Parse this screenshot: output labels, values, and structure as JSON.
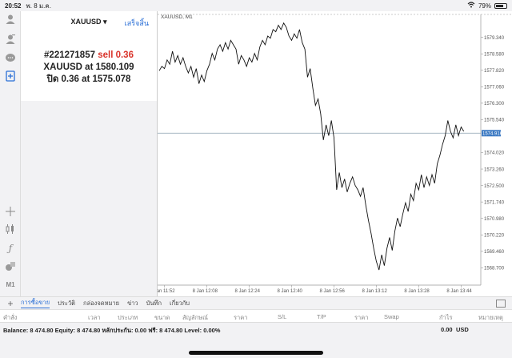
{
  "statusbar": {
    "time": "20:52",
    "date": "พ. 8 ม.ค.",
    "battery": "79%",
    "battery_level": 0.79
  },
  "left_tools": [
    {
      "icon": "person-icon"
    },
    {
      "icon": "person-add-icon"
    },
    {
      "icon": "chat-icon"
    },
    {
      "icon": "new-order-icon"
    },
    {
      "icon": "crosshair-icon"
    },
    {
      "icon": "candles-icon"
    },
    {
      "icon": "function-icon"
    },
    {
      "icon": "objects-icon"
    },
    {
      "icon": "timeframe-label",
      "label": "M1"
    }
  ],
  "order_panel": {
    "symbol": "XAUUSD ▾",
    "done": "เสร็จสิ้น",
    "ticket": "#221271857",
    "side": "sell 0.36",
    "open_line": "XAUUSD at 1580.109",
    "close_line": "ปิด 0.36 at 1575.078"
  },
  "chart_data": {
    "type": "line",
    "title": "XAUUSD, M1",
    "price_labels": [
      "1579.340",
      "1578.580",
      "1577.820",
      "1577.060",
      "1576.300",
      "1575.540",
      "1574.020",
      "1573.260",
      "1572.500",
      "1571.740",
      "1570.980",
      "1570.220",
      "1569.460",
      "1568.700"
    ],
    "price_ticks": [
      1579.34,
      1578.58,
      1577.82,
      1577.06,
      1576.3,
      1575.54,
      1574.02,
      1573.26,
      1572.5,
      1571.74,
      1570.98,
      1570.22,
      1569.46,
      1568.7
    ],
    "current_price": "1574.916",
    "current_value": 1574.916,
    "time_labels": [
      "8 Jan 11:52",
      "8 Jan 12:08",
      "8 Jan 12:24",
      "8 Jan 12:40",
      "8 Jan 12:56",
      "8 Jan 13:12",
      "8 Jan 13:28",
      "8 Jan 13:44"
    ],
    "time_ticks": [
      0,
      16,
      32,
      48,
      64,
      80,
      96,
      112
    ],
    "ylim": [
      1567.9,
      1580.4
    ],
    "xlim": [
      -2,
      114
    ],
    "x": [
      -2,
      -1,
      0,
      1,
      2,
      3,
      4,
      5,
      6,
      7,
      8,
      9,
      10,
      11,
      12,
      13,
      14,
      15,
      16,
      17,
      18,
      19,
      20,
      21,
      22,
      23,
      24,
      25,
      26,
      27,
      28,
      29,
      30,
      31,
      32,
      33,
      34,
      35,
      36,
      37,
      38,
      39,
      40,
      41,
      42,
      43,
      44,
      45,
      46,
      47,
      48,
      49,
      50,
      51,
      52,
      53,
      54,
      55,
      56,
      57,
      58,
      59,
      60,
      61,
      62,
      63,
      64,
      65,
      66,
      67,
      68,
      69,
      70,
      71,
      72,
      73,
      74,
      75,
      76,
      77,
      78,
      79,
      80,
      81,
      82,
      83,
      84,
      85,
      86,
      87,
      88,
      89,
      90,
      91,
      92,
      93,
      94,
      95,
      96,
      97,
      98,
      99,
      100,
      101,
      102,
      103,
      104,
      105,
      106,
      107,
      108,
      109,
      110,
      111,
      112,
      113
    ],
    "values": [
      1577.8,
      1578.0,
      1577.9,
      1578.3,
      1578.1,
      1578.7,
      1578.2,
      1578.5,
      1578.1,
      1578.4,
      1578.0,
      1577.7,
      1578.0,
      1577.5,
      1577.9,
      1577.2,
      1577.6,
      1577.3,
      1577.8,
      1578.1,
      1578.6,
      1578.3,
      1578.8,
      1579.0,
      1578.7,
      1579.1,
      1578.8,
      1579.2,
      1579.0,
      1578.8,
      1578.1,
      1578.5,
      1578.3,
      1578.0,
      1578.4,
      1578.2,
      1578.6,
      1578.3,
      1578.9,
      1579.2,
      1579.0,
      1579.4,
      1579.3,
      1579.7,
      1579.6,
      1579.9,
      1579.7,
      1580.0,
      1579.8,
      1579.4,
      1579.2,
      1579.5,
      1579.3,
      1579.7,
      1579.1,
      1578.8,
      1577.5,
      1577.9,
      1577.0,
      1576.2,
      1576.5,
      1575.8,
      1574.6,
      1575.3,
      1574.8,
      1575.5,
      1574.7,
      1572.3,
      1573.1,
      1572.4,
      1572.8,
      1572.2,
      1572.6,
      1572.9,
      1572.5,
      1572.3,
      1572.0,
      1572.4,
      1571.6,
      1570.9,
      1570.3,
      1569.6,
      1569.0,
      1568.6,
      1569.3,
      1568.8,
      1569.6,
      1570.1,
      1569.5,
      1570.4,
      1571.0,
      1570.6,
      1571.2,
      1571.7,
      1571.3,
      1572.1,
      1571.8,
      1572.6,
      1572.3,
      1573.0,
      1572.4,
      1572.9,
      1572.5,
      1573.0,
      1572.6,
      1573.5,
      1573.9,
      1574.4,
      1574.8,
      1575.5,
      1575.0,
      1574.7,
      1575.3,
      1574.8,
      1575.2,
      1575.0
    ],
    "grid": false
  },
  "tabs": [
    "การซื้อขาย",
    "ประวัติ",
    "กล่องจดหมาย",
    "ข่าว",
    "บันทึก",
    "เกี่ยวกับ"
  ],
  "columns": [
    "คำสั่ง",
    "เวลา",
    "ประเภท",
    "ขนาด",
    "สัญลักษณ์",
    "ราคา",
    "S/L",
    "T/P",
    "ราคา",
    "Swap",
    "กำไร",
    "หมายเหตุ"
  ],
  "balance": {
    "summary": "Balance: 8 474.80  Equity: 8 474.80  หลักประกัน: 0.00  ฟรี: 8 474.80  Level: 0.00%",
    "profit": "0.00",
    "currency": "USD"
  }
}
